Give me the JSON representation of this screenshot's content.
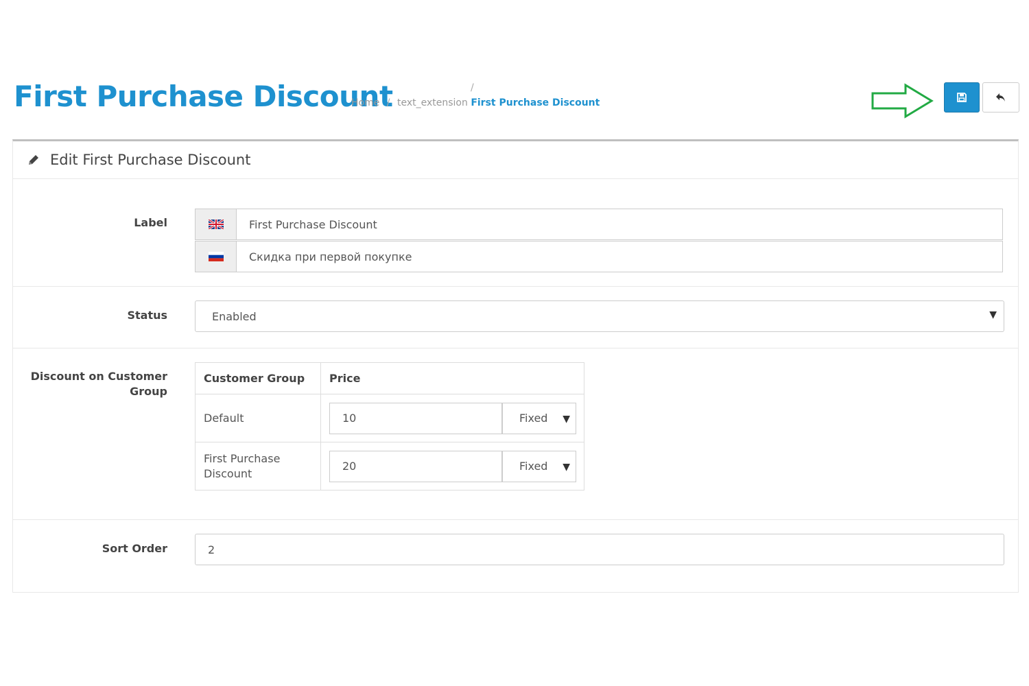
{
  "header": {
    "title": "First Purchase Discount",
    "breadcrumb": [
      {
        "label": "Home"
      },
      {
        "label": "text_extension"
      },
      {
        "label": "First Purchase Discount"
      }
    ]
  },
  "toolbar": {
    "save_icon": "save-icon",
    "back_icon": "reply-icon",
    "annotation_arrow_color": "#22aa44",
    "primary_color": "#1e91cf"
  },
  "panel": {
    "title": "Edit First Purchase Discount",
    "icon": "pencil-icon"
  },
  "form": {
    "label": {
      "label": "Label",
      "values": [
        {
          "flag": "gb-flag-icon",
          "value": "First Purchase Discount"
        },
        {
          "flag": "ru-flag-icon",
          "value": "Скидка при первой покупке"
        }
      ]
    },
    "status": {
      "label": "Status",
      "selected": "Enabled"
    },
    "discount": {
      "label_line1": "Discount on Customer",
      "label_line2": "Group",
      "columns": [
        "Customer Group",
        "Price"
      ],
      "rows": [
        {
          "group": "Default",
          "group_line2": "",
          "price": "10",
          "type": "Fixed"
        },
        {
          "group": "First Purchase",
          "group_line2": "Discount",
          "price": "20",
          "type": "Fixed"
        }
      ]
    },
    "sort_order": {
      "label": "Sort Order",
      "value": "2"
    }
  }
}
